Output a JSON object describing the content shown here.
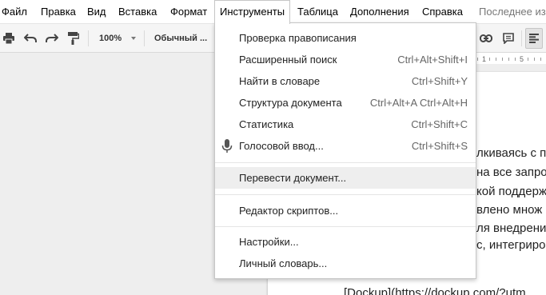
{
  "menubar": {
    "items": [
      "Файл",
      "Правка",
      "Вид",
      "Вставка",
      "Формат",
      "Инструменты",
      "Таблица",
      "Дополнения",
      "Справка"
    ],
    "saved_status": "Последнее из"
  },
  "toolbar": {
    "zoom": "100%",
    "style": "Обычный ..."
  },
  "ruler": {
    "labels": [
      "1",
      "5"
    ]
  },
  "tools_menu": {
    "items": [
      {
        "label": "Проверка правописания",
        "shortcut": ""
      },
      {
        "label": "Расширенный поиск",
        "shortcut": "Ctrl+Alt+Shift+I"
      },
      {
        "label": "Найти в словаре",
        "shortcut": "Ctrl+Shift+Y"
      },
      {
        "label": "Структура документа",
        "shortcut": "Ctrl+Alt+A Ctrl+Alt+H"
      },
      {
        "label": "Статистика",
        "shortcut": "Ctrl+Shift+C"
      },
      {
        "label": "Голосовой ввод...",
        "shortcut": "Ctrl+Shift+S",
        "icon": "microphone-icon"
      },
      {
        "label": "Перевести документ...",
        "shortcut": "",
        "highlighted": true
      },
      {
        "label": "Редактор скриптов...",
        "shortcut": ""
      },
      {
        "label": "Настройки...",
        "shortcut": ""
      },
      {
        "label": "Личный словарь...",
        "shortcut": ""
      }
    ]
  },
  "document": {
    "lines": [
      "лкиваясь с п",
      "на все запро",
      "кой поддерж",
      "влено множ",
      "ля внедрени",
      "с, интегриро",
      "[Dockup](https://dockup.com/?utm"
    ]
  },
  "colors": {
    "menu_hover": "#eeeeee",
    "workspace": "#eeeeee",
    "toolbar": "#f5f5f5",
    "border": "#c6c6c6"
  }
}
